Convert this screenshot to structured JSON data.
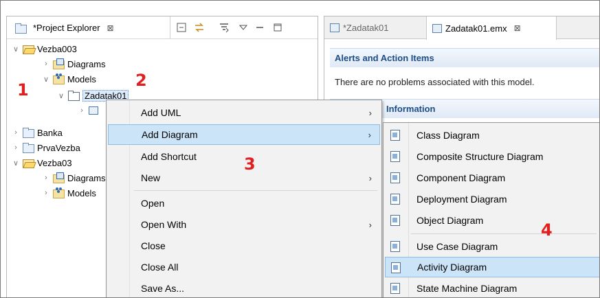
{
  "project_explorer": {
    "tab_title": "*Project Explorer",
    "close_glyph": "⊠",
    "toolbar_icons": [
      "collapse-all-icon",
      "link-with-editor-icon",
      "filter-icon",
      "view-menu-icon",
      "minimize-icon",
      "maximize-icon"
    ],
    "tree": {
      "vezba003": "Vezba003",
      "diagrams": "Diagrams",
      "models": "Models",
      "zadatak01": "Zadatak01",
      "banka": "Banka",
      "prvavezba": "PrvaVezba",
      "vezba03": "Vezba03",
      "diagrams2": "Diagrams",
      "models2": "Models"
    }
  },
  "editor": {
    "tabs": [
      {
        "label": "*Zadatak01",
        "active": false
      },
      {
        "label": "Zadatak01.emx",
        "active": true
      }
    ],
    "close_glyph": "⊠",
    "alerts_header": "Alerts and Action Items",
    "alerts_text": "There are no problems associated with this model.",
    "info_header": "Information"
  },
  "context_menu": {
    "items": [
      {
        "label": "Add UML",
        "submenu": true
      },
      {
        "label": "Add Diagram",
        "submenu": true,
        "highlighted": true
      },
      {
        "label": "Add Shortcut",
        "submenu": false
      },
      {
        "label": "New",
        "submenu": true
      },
      {
        "label": "Open",
        "submenu": false
      },
      {
        "label": "Open With",
        "submenu": true
      },
      {
        "label": "Close",
        "submenu": false
      },
      {
        "label": "Close All",
        "submenu": false
      },
      {
        "label": "Save As...",
        "submenu": false
      }
    ],
    "arrow_glyph": "›"
  },
  "submenu": {
    "items": [
      {
        "label": "Class Diagram"
      },
      {
        "label": "Composite Structure Diagram"
      },
      {
        "label": "Component Diagram"
      },
      {
        "label": "Deployment Diagram"
      },
      {
        "label": "Object Diagram"
      },
      {
        "label": "Use Case Diagram"
      },
      {
        "label": "Activity Diagram",
        "highlighted": true
      },
      {
        "label": "State Machine Diagram"
      }
    ]
  },
  "step_markers": [
    "1",
    "2",
    "3",
    "4"
  ],
  "colors": {
    "marker": "#e02020",
    "selection": "#cce4f7",
    "header_text": "#1c4c86"
  }
}
